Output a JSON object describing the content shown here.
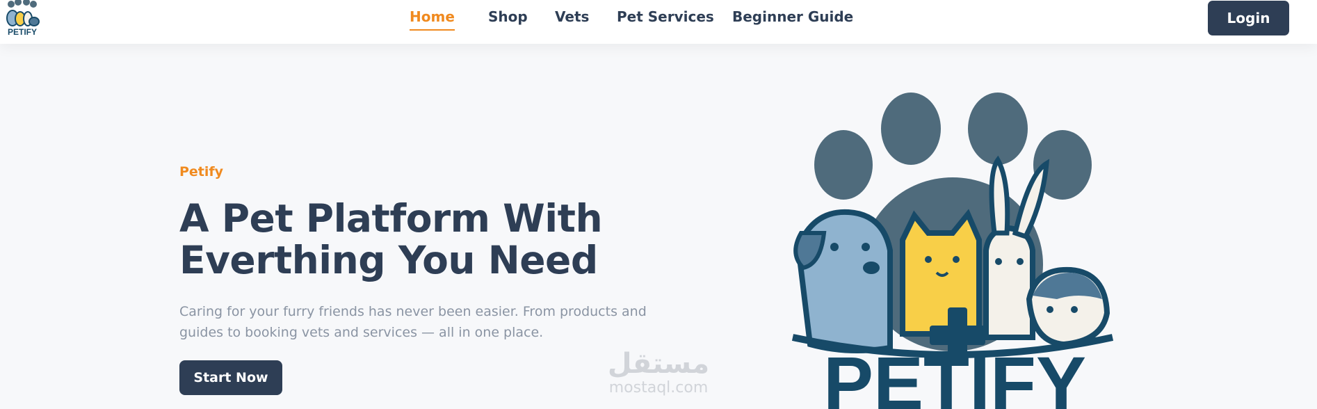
{
  "header": {
    "logo_text": "PETIFY",
    "nav": [
      {
        "label": "Home",
        "active": true
      },
      {
        "label": "Shop",
        "active": false
      },
      {
        "label": "Vets",
        "active": false
      },
      {
        "label": "Pet Services",
        "active": false
      },
      {
        "label": "Beginner Guide",
        "active": false
      }
    ],
    "login_label": "Login"
  },
  "hero": {
    "eyebrow": "Petify",
    "headline_line1": "A Pet Platform With",
    "headline_line2": "Everthing You Need",
    "subtext_line1": "Caring for your furry friends has never been easier. From products and",
    "subtext_line2": "guides to booking vets and services — all in one place.",
    "cta_label": "Start Now",
    "art_wordmark": "PETIFY"
  },
  "watermark": {
    "arabic": "مستقل",
    "latin": "mostaql.com"
  },
  "colors": {
    "accent": "#f08a1f",
    "navy": "#2e3e55",
    "background": "#f7f8fa",
    "muted_text": "#8a94a3"
  }
}
